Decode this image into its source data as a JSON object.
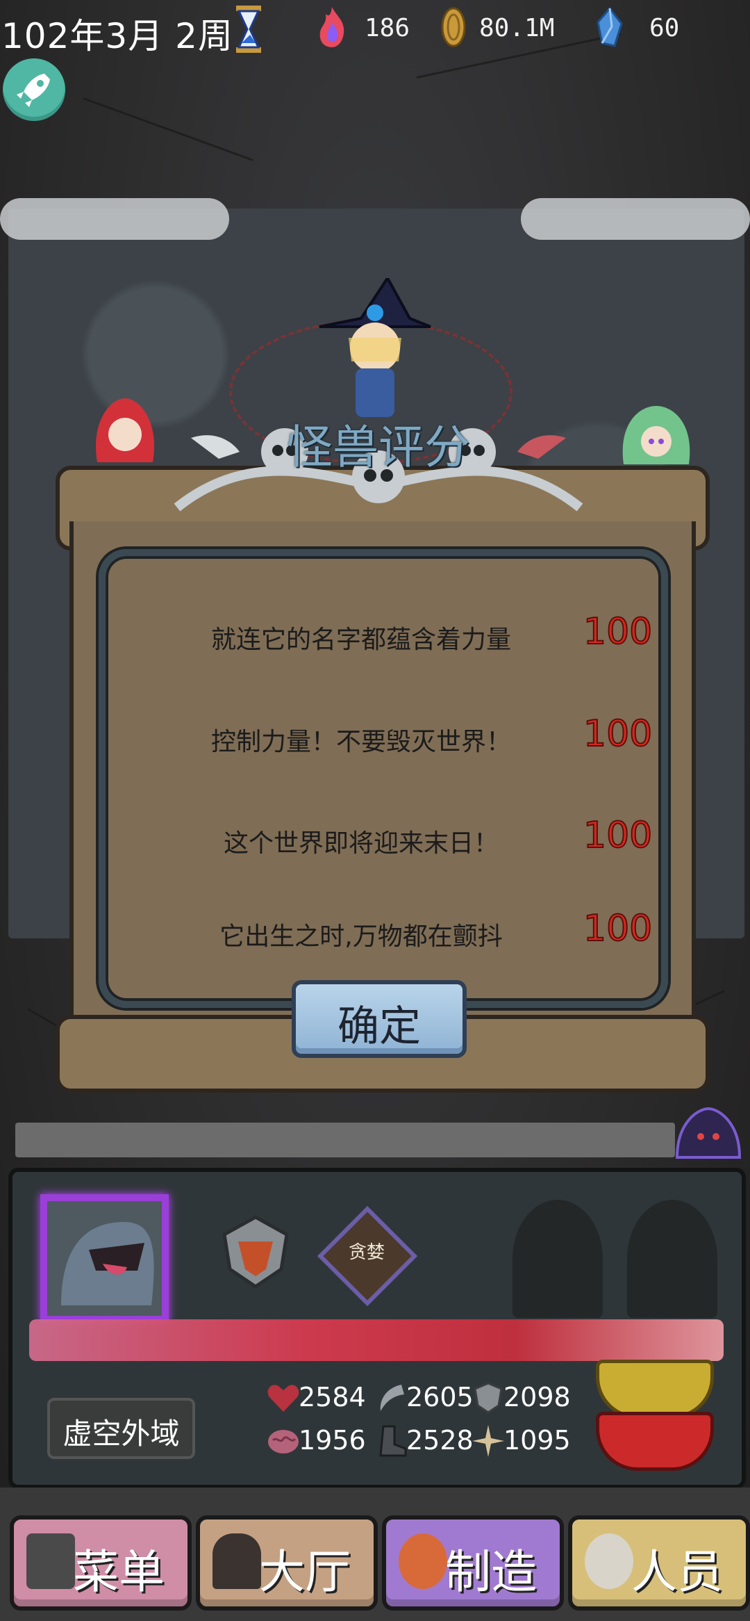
{
  "status_bar": {
    "date": "102年3月 2周",
    "fire": "186",
    "gold": "80.1M",
    "gem": "60"
  },
  "dialog": {
    "title": "怪兽评分",
    "rows": [
      {
        "text": "就连它的名字都蕴含着力量",
        "score": "100"
      },
      {
        "text": "控制力量！不要毁灭世界！",
        "score": "100"
      },
      {
        "text": "这个世界即将迎来末日！",
        "score": "100"
      },
      {
        "text": "它出生之时,万物都在颤抖",
        "score": "100"
      }
    ],
    "confirm_label": "确定"
  },
  "monster_panel": {
    "trait_badge": "贪婪",
    "domain_label": "虚空外域",
    "stats": {
      "hp": "2584",
      "attack": "2605",
      "defense": "2098",
      "intellect": "1956",
      "speed": "2528",
      "luck": "1095"
    }
  },
  "nav": {
    "menu": "菜单",
    "hall": "大厅",
    "craft": "制造",
    "staff": "人员"
  },
  "colors": {
    "score_red": "#d5291f",
    "title_blue": "#7fa9c4",
    "portrait_glow": "#9a3fd8",
    "rocket_teal": "#4fb7a4"
  }
}
